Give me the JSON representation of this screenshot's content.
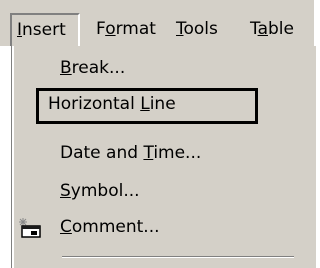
{
  "menubar": {
    "items": [
      {
        "pre": "",
        "key": "I",
        "post": "nsert"
      },
      {
        "pre": "F",
        "key": "o",
        "post": "rmat"
      },
      {
        "pre": "",
        "key": "T",
        "post": "ools"
      },
      {
        "pre": "T",
        "key": "a",
        "post": "ble"
      }
    ]
  },
  "menu": {
    "items": [
      {
        "pre": "",
        "key": "B",
        "post": "reak..."
      },
      {
        "pre": "Horizontal ",
        "key": "L",
        "post": "ine"
      },
      {
        "pre": "Date and ",
        "key": "T",
        "post": "ime..."
      },
      {
        "pre": "",
        "key": "S",
        "post": "ymbol..."
      },
      {
        "pre": "",
        "key": "C",
        "post": "omment...",
        "icon": "comment-icon"
      }
    ]
  }
}
